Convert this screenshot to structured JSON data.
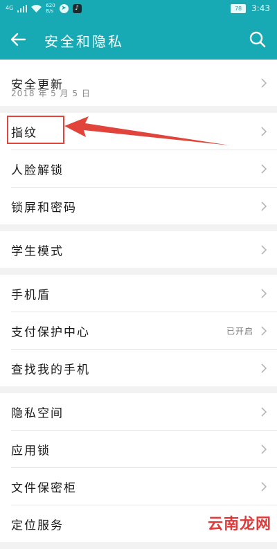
{
  "status_bar": {
    "network_label": "4G",
    "speed_value": "620",
    "speed_unit": "B/s",
    "battery": "78",
    "time": "3:43"
  },
  "app_bar": {
    "title": "安全和隐私"
  },
  "groups": [
    {
      "items": [
        {
          "label": "安全更新",
          "subtitle": "2018 年 5 月 5 日"
        }
      ]
    },
    {
      "items": [
        {
          "label": "指纹"
        },
        {
          "label": "人脸解锁"
        },
        {
          "label": "锁屏和密码"
        }
      ]
    },
    {
      "items": [
        {
          "label": "学生模式"
        }
      ]
    },
    {
      "items": [
        {
          "label": "手机盾"
        },
        {
          "label": "支付保护中心",
          "value": "已开启"
        },
        {
          "label": "查找我的手机"
        }
      ]
    },
    {
      "items": [
        {
          "label": "隐私空间"
        },
        {
          "label": "应用锁"
        },
        {
          "label": "文件保密柜"
        },
        {
          "label": "定位服务"
        }
      ]
    }
  ],
  "watermark": "云南龙网",
  "colors": {
    "accent": "#17aab4",
    "annotation": "#e0443b"
  }
}
